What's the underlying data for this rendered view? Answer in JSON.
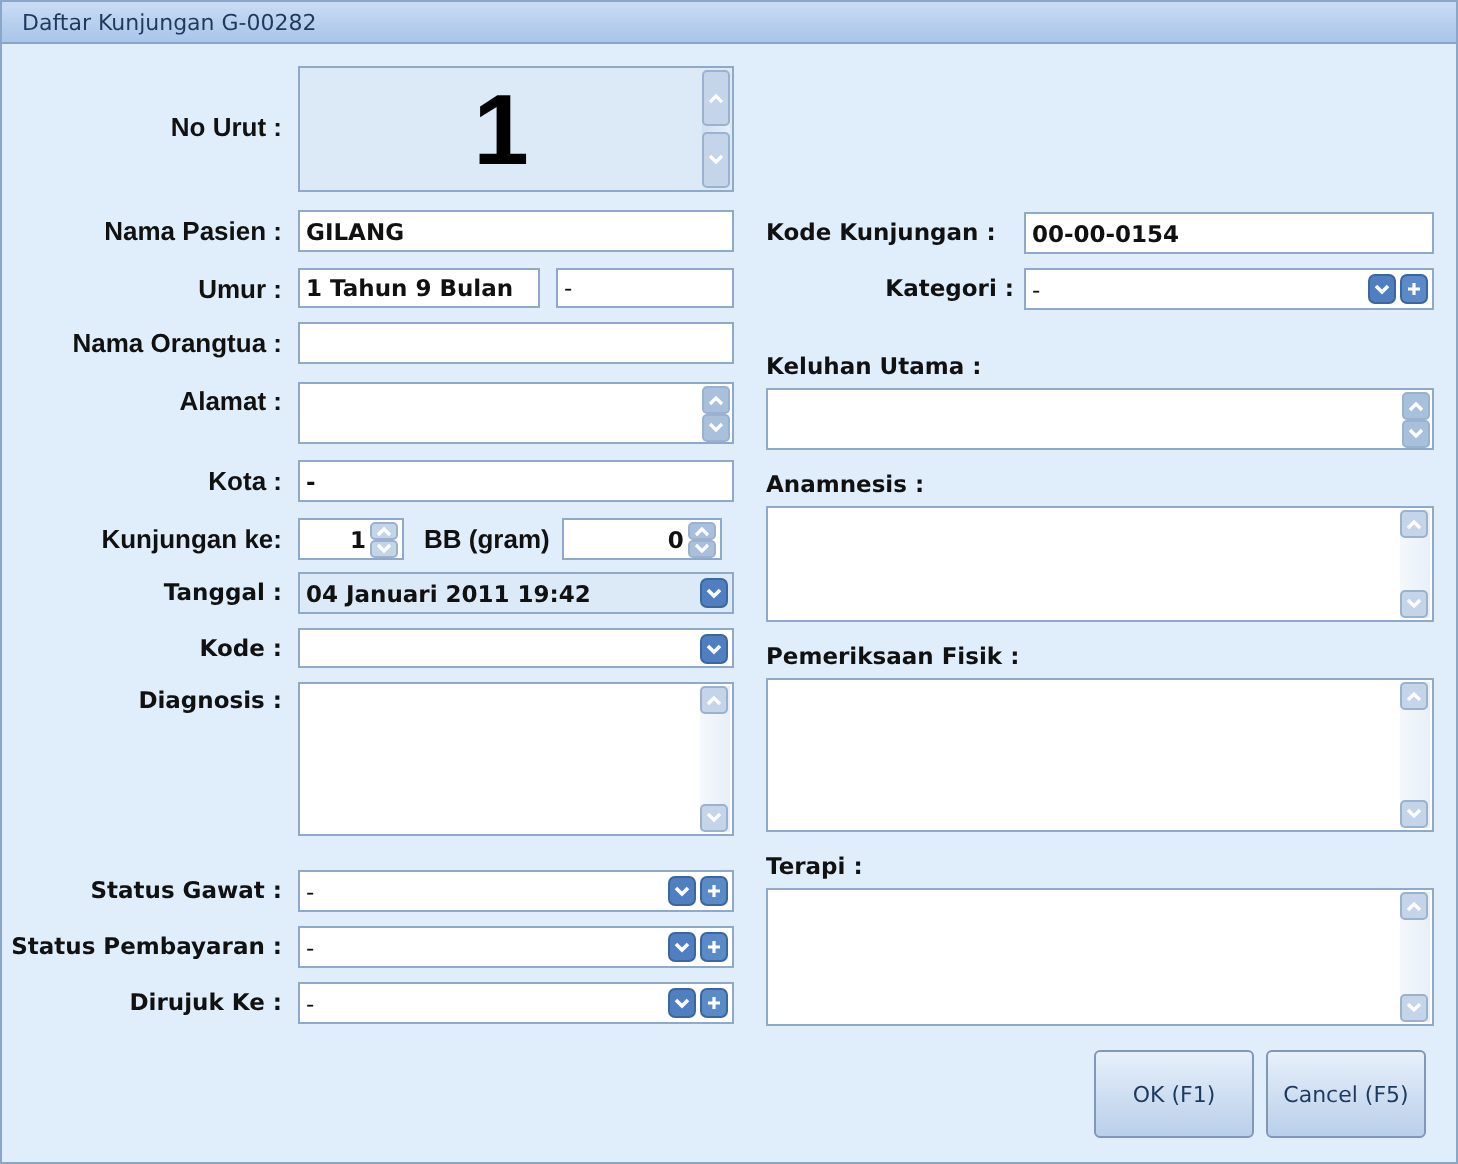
{
  "window": {
    "title": "Daftar Kunjungan G-00282"
  },
  "left_fields": [
    {
      "kind": "counter",
      "label": "No Urut :",
      "value": "1"
    },
    {
      "kind": "text",
      "label": "Nama Pasien :",
      "value": "GILANG"
    },
    {
      "kind": "pair",
      "label": "Umur :",
      "value": "1 Tahun 9 Bulan",
      "value_2": "-"
    },
    {
      "kind": "text",
      "label": "Nama Orangtua :"
    },
    {
      "kind": "note",
      "label": "Alamat :"
    },
    {
      "kind": "text",
      "label": "Kota :",
      "value": "-"
    },
    {
      "kind": "spins",
      "label": "Kunjungan ke:",
      "value": "1",
      "label_2": "BB (gram)",
      "value_2": "0"
    },
    {
      "kind": "date",
      "label": "Tanggal :",
      "value": "04 Januari 2011 19:42"
    },
    {
      "kind": "combo",
      "label": "Kode :"
    },
    {
      "kind": "memo",
      "label": "Diagnosis :"
    },
    {
      "kind": "combo_add",
      "label": "Status Gawat :",
      "value": "-"
    },
    {
      "kind": "combo_add",
      "label": "Status Pembayaran :",
      "value": "-"
    },
    {
      "kind": "combo_add",
      "label": "Dirujuk Ke :",
      "value": "-"
    }
  ],
  "right_fields": [
    {
      "kind": "text",
      "label": "Kode Kunjungan :",
      "value": "00-00-0154"
    },
    {
      "kind": "combo_add",
      "label": "Kategori :",
      "value": "-"
    },
    {
      "kind": "note",
      "label": "Keluhan Utama :"
    },
    {
      "kind": "memo",
      "label": "Anamnesis :"
    },
    {
      "kind": "memo",
      "label": "Pemeriksaan Fisik :"
    },
    {
      "kind": "memo",
      "label": "Terapi :"
    }
  ],
  "buttons": [
    "OK (F1)",
    "Cancel (F5)"
  ]
}
